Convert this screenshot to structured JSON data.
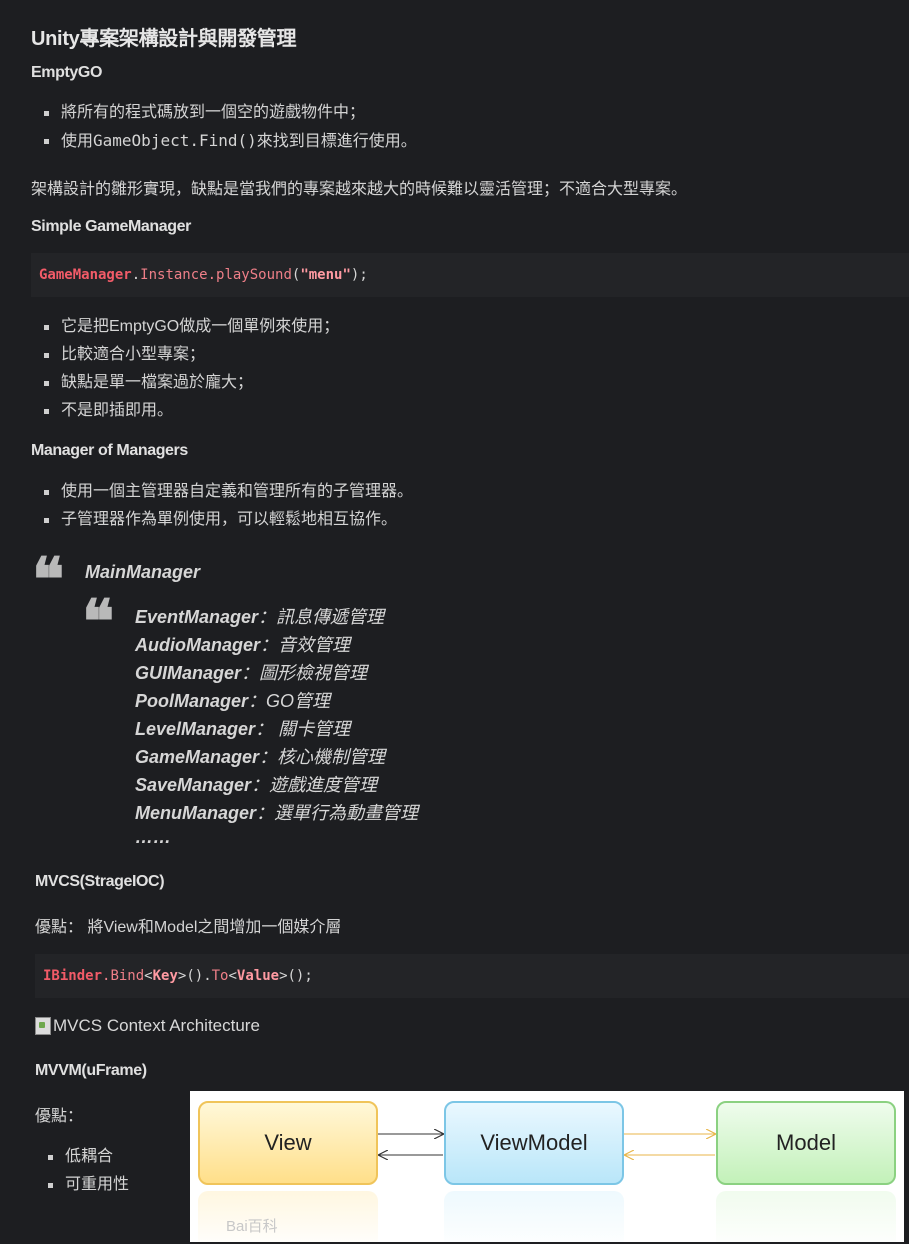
{
  "title": "Unity專案架構設計與開發管理",
  "sections": {
    "emptygo": {
      "heading": "EmptyGO",
      "items": [
        "將所有的程式碼放到一個空的遊戲物件中；",
        "使用",
        "GameObject.Find()",
        "來找到目標進行使用。"
      ],
      "note": "架構設計的雛形實現，缺點是當我們的專案越來越大的時候難以靈活管理；不適合大型專案。"
    },
    "simple": {
      "heading": "Simple GameManager",
      "code": {
        "class": "GameManager",
        "dot1": ".",
        "method": "Instance.playSound",
        "open": "(",
        "str": "\"menu\"",
        "close": ");"
      },
      "items": [
        "它是把EmptyGO做成一個單例來使用；",
        "比較適合小型專案；",
        "缺點是單一檔案過於龐大；",
        "不是即插即用。"
      ]
    },
    "mom": {
      "heading": "Manager of Managers",
      "items": [
        "使用一個主管理器自定義和管理所有的子管理器。",
        "子管理器作為單例使用，可以輕鬆地相互協作。"
      ],
      "main": "MainManager",
      "subs": [
        {
          "name": "EventManager",
          "desc": "：訊息傳遞管理"
        },
        {
          "name": "AudioManager",
          "desc": "：音效管理"
        },
        {
          "name": "GUIManager",
          "desc": "：圖形檢視管理"
        },
        {
          "name": "PoolManager",
          "desc": "：GO管理"
        },
        {
          "name": "LevelManager",
          "desc": "： 關卡管理"
        },
        {
          "name": "GameManager",
          "desc": "：核心機制管理"
        },
        {
          "name": "SaveManager",
          "desc": "：遊戲進度管理"
        },
        {
          "name": "MenuManager",
          "desc": "：選單行為動畫管理"
        }
      ],
      "ellipsis": "……"
    },
    "mvcs": {
      "heading": "MVCS(StrageIOC)",
      "pros": "優點： 將View和Model之間增加一個媒介層",
      "code": {
        "a": "IBinder",
        "b": ".Bind",
        "c": "<",
        "d": "Key",
        "e": ">().",
        "f": "To",
        "g": "<",
        "h": "Value",
        "i": ">();"
      },
      "broken_image_alt": "MVCS Context Architecture"
    },
    "mvvm": {
      "heading": "MVVM(uFrame)",
      "pros": "優點：",
      "items": [
        "低耦合",
        "可重用性"
      ],
      "diagram": {
        "view": "View",
        "viewmodel": "ViewModel",
        "model": "Model",
        "watermark": "Bai百科"
      }
    }
  },
  "colors": {
    "background": "#1d1e21",
    "code_bg": "#232427",
    "code_keyword": "#f25b68"
  }
}
